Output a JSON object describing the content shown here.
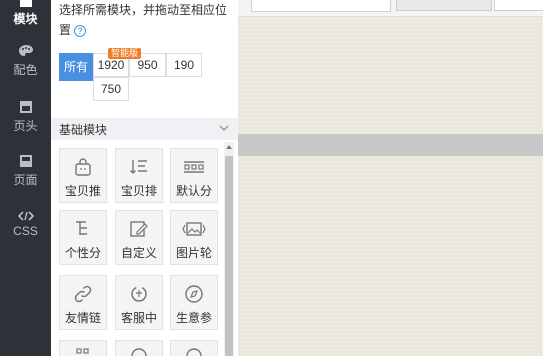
{
  "nav": [
    {
      "id": "modules",
      "label": "模块",
      "icon": "module-icon",
      "active": true
    },
    {
      "id": "colors",
      "label": "配色",
      "icon": "palette-icon",
      "active": false
    },
    {
      "id": "header",
      "label": "页头",
      "icon": "page-header-icon",
      "active": false
    },
    {
      "id": "page",
      "label": "页面",
      "icon": "page-icon",
      "active": false
    },
    {
      "id": "css",
      "label": "CSS",
      "icon": "code-icon",
      "active": false
    }
  ],
  "panel": {
    "tip": "选择所需模块，并拖动至相应位置",
    "filters": [
      {
        "label": "所有",
        "active": true
      },
      {
        "label": "1920",
        "active": false
      },
      {
        "label": "950",
        "active": false
      },
      {
        "label": "190",
        "active": false
      },
      {
        "label": "750",
        "active": false
      }
    ],
    "badge": "智能版",
    "section_title": "基础模块",
    "modules": [
      {
        "label": "宝贝推",
        "icon": "bag-icon"
      },
      {
        "label": "宝贝排",
        "icon": "sort-list-icon"
      },
      {
        "label": "默认分",
        "icon": "category-icon"
      },
      {
        "label": "个性分",
        "icon": "tree-icon"
      },
      {
        "label": "自定义",
        "icon": "custom-edit-icon"
      },
      {
        "label": "图片轮",
        "icon": "image-carousel-icon"
      },
      {
        "label": "友情链",
        "icon": "link-icon"
      },
      {
        "label": "客服中",
        "icon": "headset-icon"
      },
      {
        "label": "生意参",
        "icon": "compass-icon"
      }
    ]
  },
  "colors": {
    "nav_bg": "#2d3239",
    "accent": "#4a90e2",
    "badge": "#f07c2a"
  }
}
